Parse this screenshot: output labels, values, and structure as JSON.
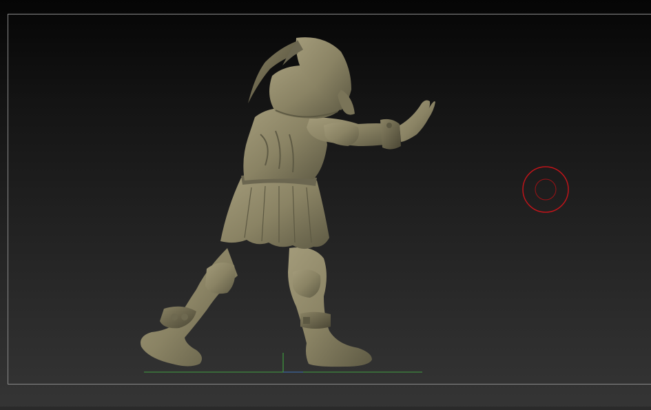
{
  "app": {
    "title": ""
  },
  "viewport": {
    "background_top": "#050505",
    "background_bottom": "#353535",
    "frame_color": "#8a8a8a"
  },
  "model": {
    "color": "#8f8869",
    "shadow_color": "#4e4a37"
  },
  "brush_cursor": {
    "color": "#c0141a"
  },
  "axes": {
    "x_color": "#3f8a3f",
    "y_color": "#3f9a3f"
  },
  "icons": {
    "brush": "brush-cursor-icon",
    "axis": "floor-axis-icon"
  }
}
